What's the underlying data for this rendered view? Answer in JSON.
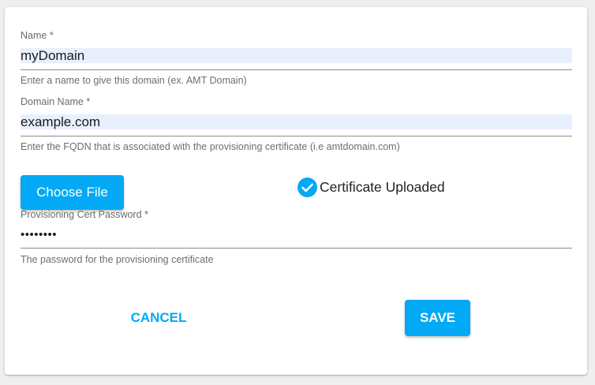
{
  "form": {
    "name": {
      "label": "Name *",
      "value": "myDomain",
      "hint": "Enter a name to give this domain (ex. AMT Domain)"
    },
    "domain_name": {
      "label": "Domain Name *",
      "value": "example.com",
      "hint": "Enter the FQDN that is associated with the provisioning certificate (i.e amtdomain.com)"
    },
    "choose_file_label": "Choose File",
    "certificate_status": {
      "text": "Certificate Uploaded",
      "icon": "check-circle-icon",
      "color": "#03a9f4"
    },
    "cert_password": {
      "label": "Provisioning Cert Password *",
      "value": "••••••••",
      "hint": "The password for the provisioning certificate"
    }
  },
  "actions": {
    "cancel_label": "CANCEL",
    "save_label": "SAVE"
  },
  "colors": {
    "accent": "#03a9f4",
    "autofill_background": "#e8f0fe"
  }
}
